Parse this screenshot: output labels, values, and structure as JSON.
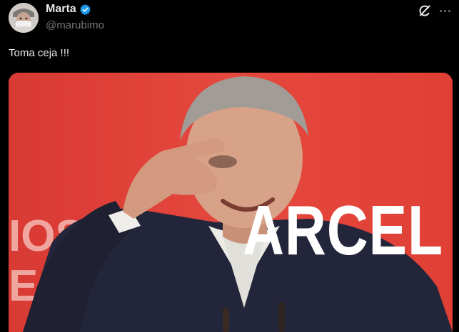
{
  "author": {
    "display_name": "Marta",
    "handle": "@marubimo",
    "verified": true,
    "avatar_icon": "avatar-photo"
  },
  "actions": {
    "grok_icon": "grok-icon",
    "more_icon": "more-options-icon"
  },
  "tweet": {
    "text": "Toma ceja !!!"
  },
  "media": {
    "overlay_text": "ARCEL",
    "background_fragments": [
      "IOS",
      "E"
    ],
    "colors": {
      "background_red": "#e0433a",
      "jacket": "#222436",
      "shirt": "#e8e6e1",
      "skin": "#d8a289",
      "hair": "#9c9792"
    }
  },
  "colors": {
    "page_background": "#000000",
    "primary_text": "#e7e9ea",
    "secondary_text": "#71767b",
    "verified_blue": "#1d9bf0"
  }
}
